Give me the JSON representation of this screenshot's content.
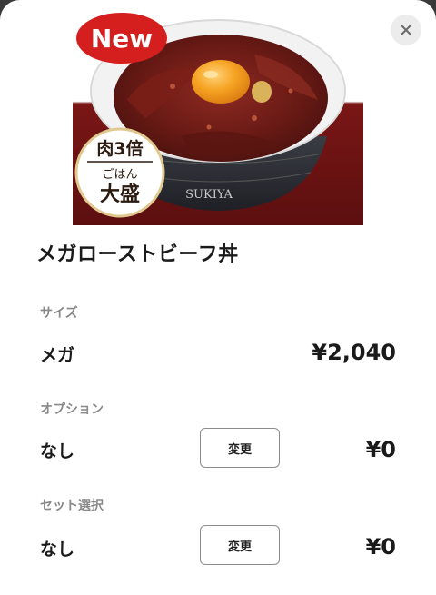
{
  "product": {
    "badge": "New",
    "badge_line1": "肉3倍",
    "badge_line2": "ごはん",
    "badge_line3": "大盛",
    "bowl_text": "SUKIYA",
    "title": "メガローストビーフ丼"
  },
  "size": {
    "section_label": "サイズ",
    "value": "メガ",
    "price": "¥2,040"
  },
  "option": {
    "section_label": "オプション",
    "value": "なし",
    "change_label": "変更",
    "price": "¥0"
  },
  "set": {
    "section_label": "セット選択",
    "value": "なし",
    "change_label": "変更",
    "price": "¥0"
  },
  "colors": {
    "badge_red": "#d51f1f",
    "photo_maroon": "#6e1414",
    "text": "#1a1a1a",
    "label": "#8a8a8a"
  },
  "icons": {
    "close": "close-icon"
  }
}
